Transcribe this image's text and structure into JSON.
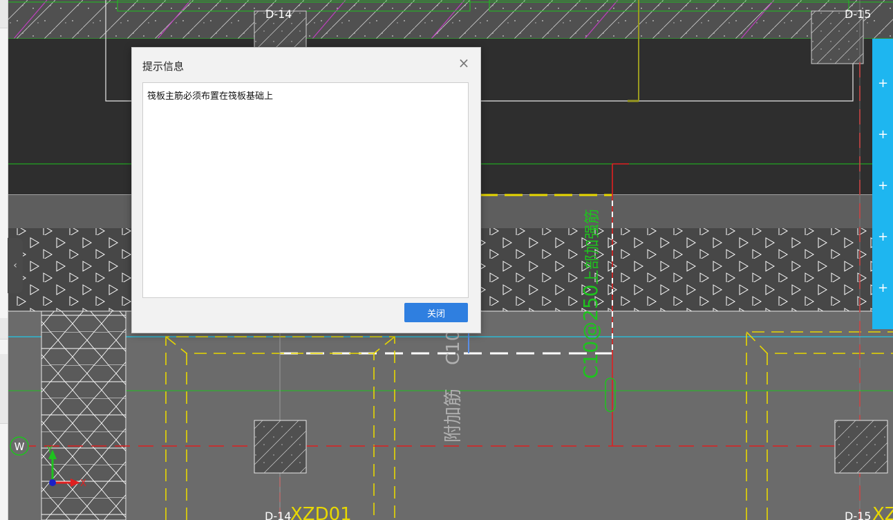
{
  "drawing": {
    "axis_labels": {
      "top_left": "D-14",
      "top_right": "D-15",
      "bottom_left": "D-14",
      "bottom_right": "D-15",
      "row_w": "W"
    },
    "rebar_label": "C10@250",
    "rebar_tag": "上部加强筋",
    "additional_rebar": "附加筋",
    "additional_rebar_spec": "C10",
    "column_tag": "XZD01",
    "column_tag_right": "XZ",
    "ucs": {
      "y": "Y",
      "x": "X"
    }
  },
  "dialog": {
    "title": "提示信息",
    "message": "筏板主筋必须布置在筏板基础上",
    "close_button": "关闭"
  },
  "colors": {
    "canvas_bg": "#6b6b6b",
    "dark_band": "#2e2e2e",
    "green_line": "#1ec31e",
    "red_line": "#e02020",
    "yellow_dash": "#e8d800",
    "cyan_line": "#20c8e8",
    "accent_button": "#2f7fe0",
    "right_strip": "#1eb6f0"
  }
}
